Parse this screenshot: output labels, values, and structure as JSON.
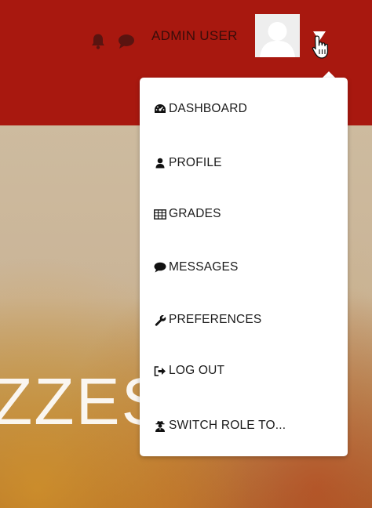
{
  "header": {
    "user_name": "ADMIN USER",
    "icons": [
      "bell-icon",
      "chat-icon",
      "avatar",
      "caret-down-icon"
    ]
  },
  "hero": {
    "text": "ZZES"
  },
  "menu": {
    "items": [
      {
        "label": "DASHBOARD",
        "icon": "dashboard-icon"
      },
      {
        "label": "PROFILE",
        "icon": "user-icon"
      },
      {
        "label": "GRADES",
        "icon": "table-icon"
      },
      {
        "label": "MESSAGES",
        "icon": "chat-icon"
      },
      {
        "label": "PREFERENCES",
        "icon": "wrench-icon"
      },
      {
        "label": "LOG OUT",
        "icon": "sign-out-icon"
      },
      {
        "label": "SWITCH ROLE TO...",
        "icon": "user-secret-icon"
      }
    ]
  },
  "colors": {
    "header_bg": "#a8180f",
    "header_text": "#3a0d0a",
    "menu_bg": "#ffffff",
    "menu_text": "#1b1b1b"
  }
}
